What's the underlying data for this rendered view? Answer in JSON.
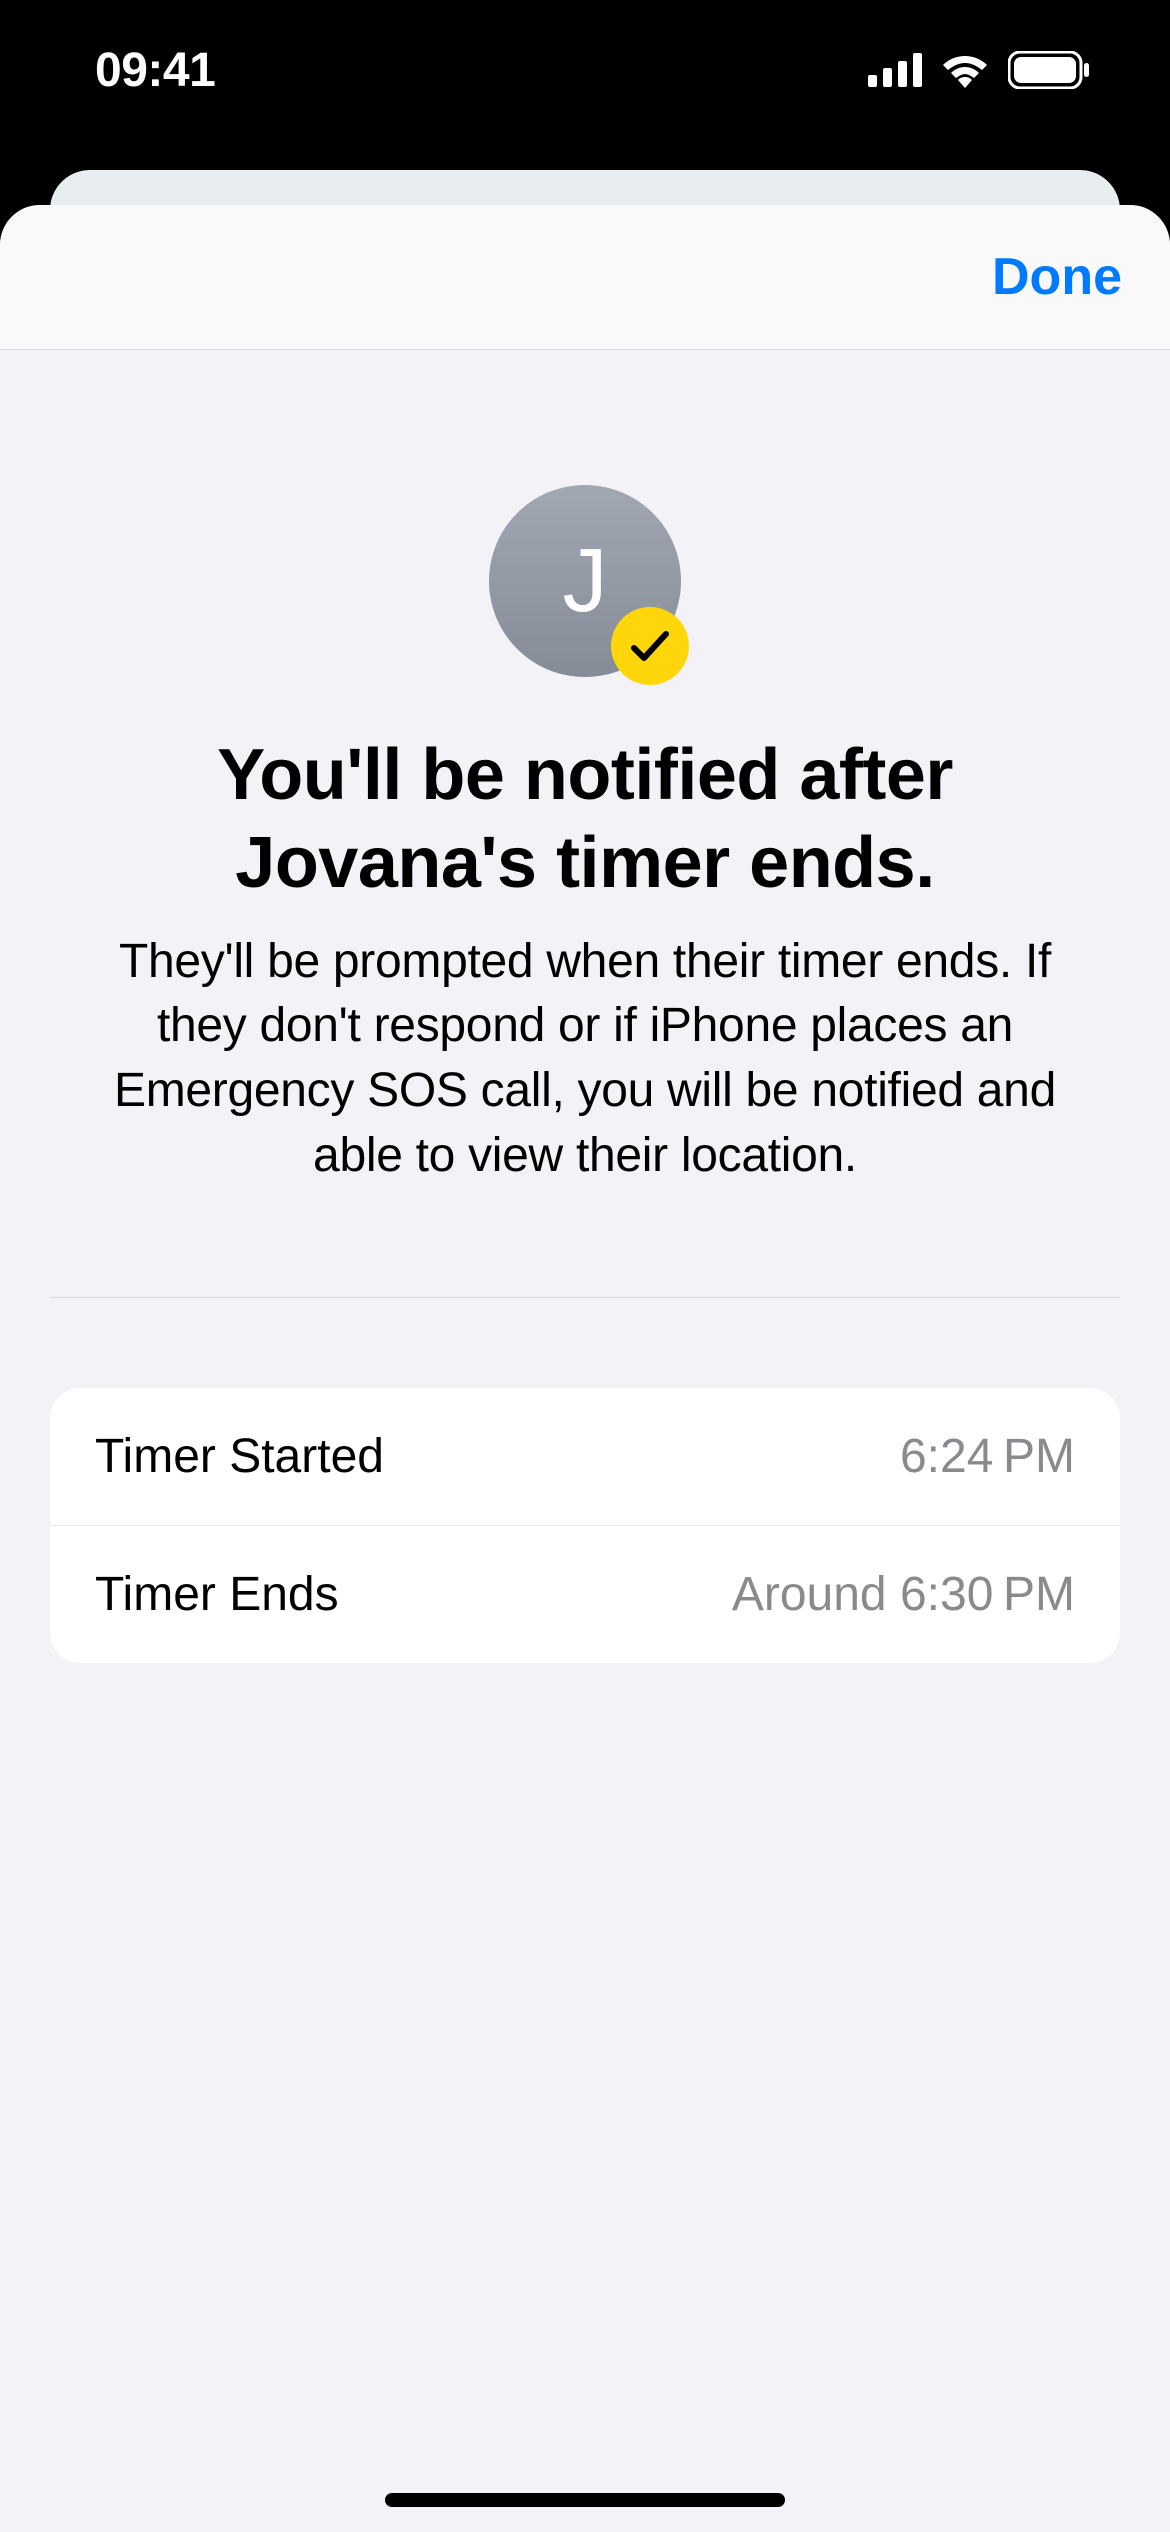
{
  "statusBar": {
    "time": "09:41"
  },
  "header": {
    "doneLabel": "Done"
  },
  "avatar": {
    "initial": "J"
  },
  "heading": "You'll be notified after Jovana's timer ends.",
  "description": "They'll be prompted when their timer ends. If they don't respond or if iPhone places an Emergency SOS call, you will be notified and able to view their location.",
  "timerInfo": {
    "startedLabel": "Timer Started",
    "startedValue": "6:24 PM",
    "endsLabel": "Timer Ends",
    "endsValue": "Around 6:30 PM"
  }
}
